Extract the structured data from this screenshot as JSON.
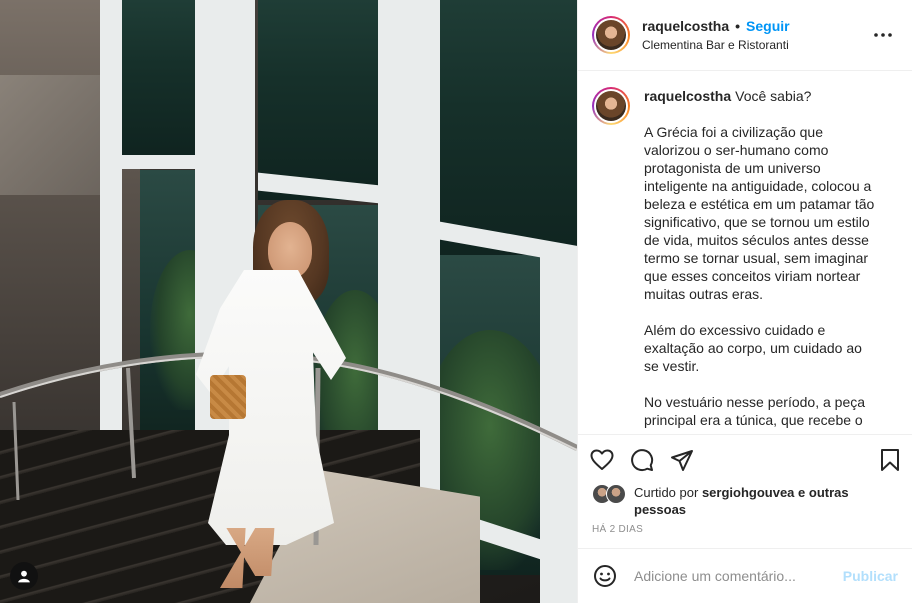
{
  "post": {
    "username": "raquelcostha",
    "follow_label": "Seguir",
    "location": "Clementina Bar e Ristoranti",
    "caption": {
      "username": "raquelcostha",
      "first_line": "Você sabia?",
      "paragraphs": [
        "A Grécia foi a civilização que valorizou o ser-humano como protagonista de um universo inteligente na antiguidade, colocou a beleza e estética em um patamar tão significativo, que se tornou um estilo de vida, muitos séculos antes desse termo se tornar usual, sem imaginar que esses conceitos viriam nortear muitas outras eras.",
        "Além do excessivo cuidado e exaltação ao corpo, um cuidado ao se vestir.",
        "No vestuário nesse período, a peça principal era a túnica, que recebe o"
      ]
    },
    "likes": {
      "prefix": "Curtido por",
      "user": "sergiohgouvea",
      "suffix": "e outras pessoas"
    },
    "timestamp": "HÁ 2 DIAS",
    "comment_box": {
      "placeholder": "Adicione um comentário...",
      "publish_label": "Publicar"
    }
  },
  "icons": {
    "more": "more-horizontal-icon",
    "like": "heart-icon",
    "comment": "comment-icon",
    "share": "send-icon",
    "save": "bookmark-icon",
    "emoji": "emoji-icon",
    "tag": "user-tag-icon"
  },
  "colors": {
    "accent": "#0095f6",
    "publish_disabled": "#b2dffc",
    "muted_text": "#8e8e8e",
    "border": "#efefef"
  }
}
